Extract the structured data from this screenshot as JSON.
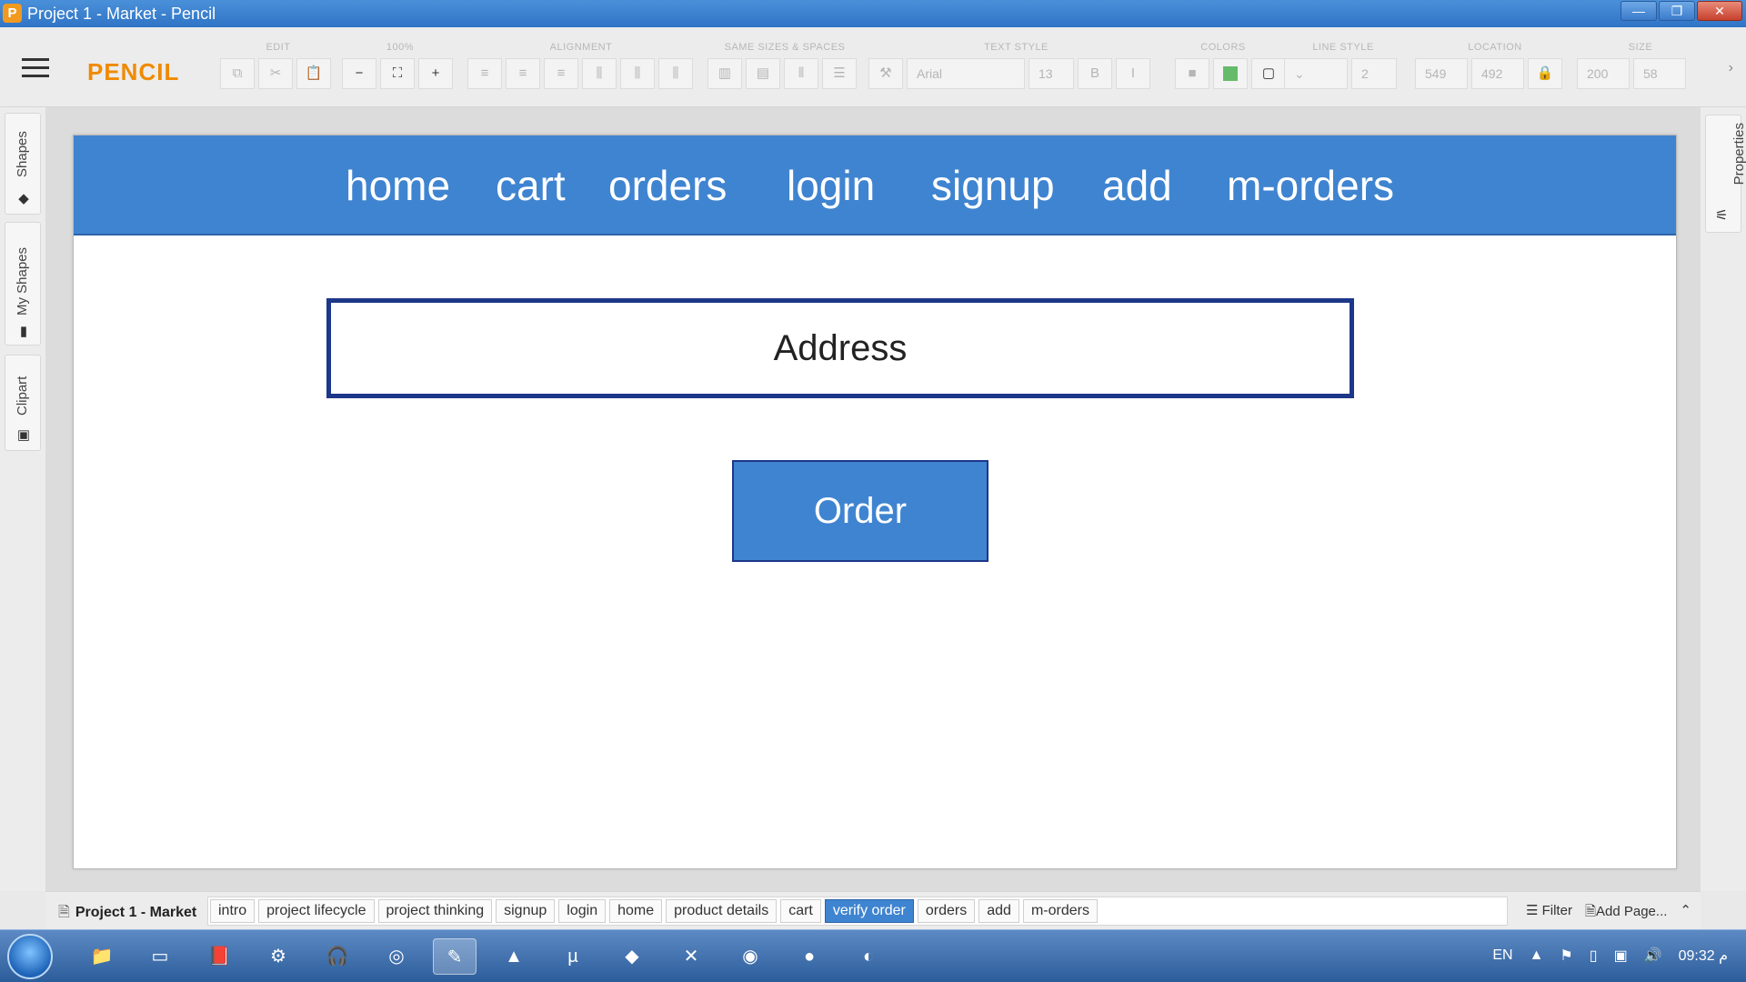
{
  "window": {
    "title": "Project 1 - Market - Pencil",
    "app_icon": "P",
    "controls": {
      "minimize": "—",
      "maximize": "❐",
      "close": "✕"
    }
  },
  "toolbar": {
    "logo": "PENCIL",
    "groups": {
      "edit": "EDIT",
      "zoom": "100%",
      "alignment": "ALIGNMENT",
      "same_sizes": "SAME SIZES & SPACES",
      "text_style": "TEXT STYLE",
      "colors": "COLORS",
      "line_style": "LINE STYLE",
      "location": "LOCATION",
      "size": "SIZE"
    },
    "font_name": "Arial",
    "font_size": "13",
    "bold": "B",
    "italic": "I",
    "line_width": "2",
    "location_x": "549",
    "location_y": "492",
    "size_w": "200",
    "size_h": "58",
    "fill_color": "#66bb6a"
  },
  "left_tabs": {
    "shapes": "Shapes",
    "my_shapes": "My Shapes",
    "clipart": "Clipart"
  },
  "right_tabs": {
    "properties": "Properties"
  },
  "mockup": {
    "nav": [
      "home",
      "cart",
      "orders",
      "login",
      "signup",
      "add",
      "m-orders"
    ],
    "address_placeholder": "Address",
    "order_button": "Order",
    "accent": "#3f84d0",
    "border": "#1d3789"
  },
  "pages_bar": {
    "project": "Project 1 - Market",
    "tabs": [
      "intro",
      "project lifecycle",
      "project thinking",
      "signup",
      "login",
      "home",
      "product details",
      "cart",
      "verify order",
      "orders",
      "add",
      "m-orders"
    ],
    "active": "verify order",
    "filter": "Filter",
    "add_page": "Add Page..."
  },
  "taskbar": {
    "lang": "EN",
    "time": "09:32 م"
  }
}
